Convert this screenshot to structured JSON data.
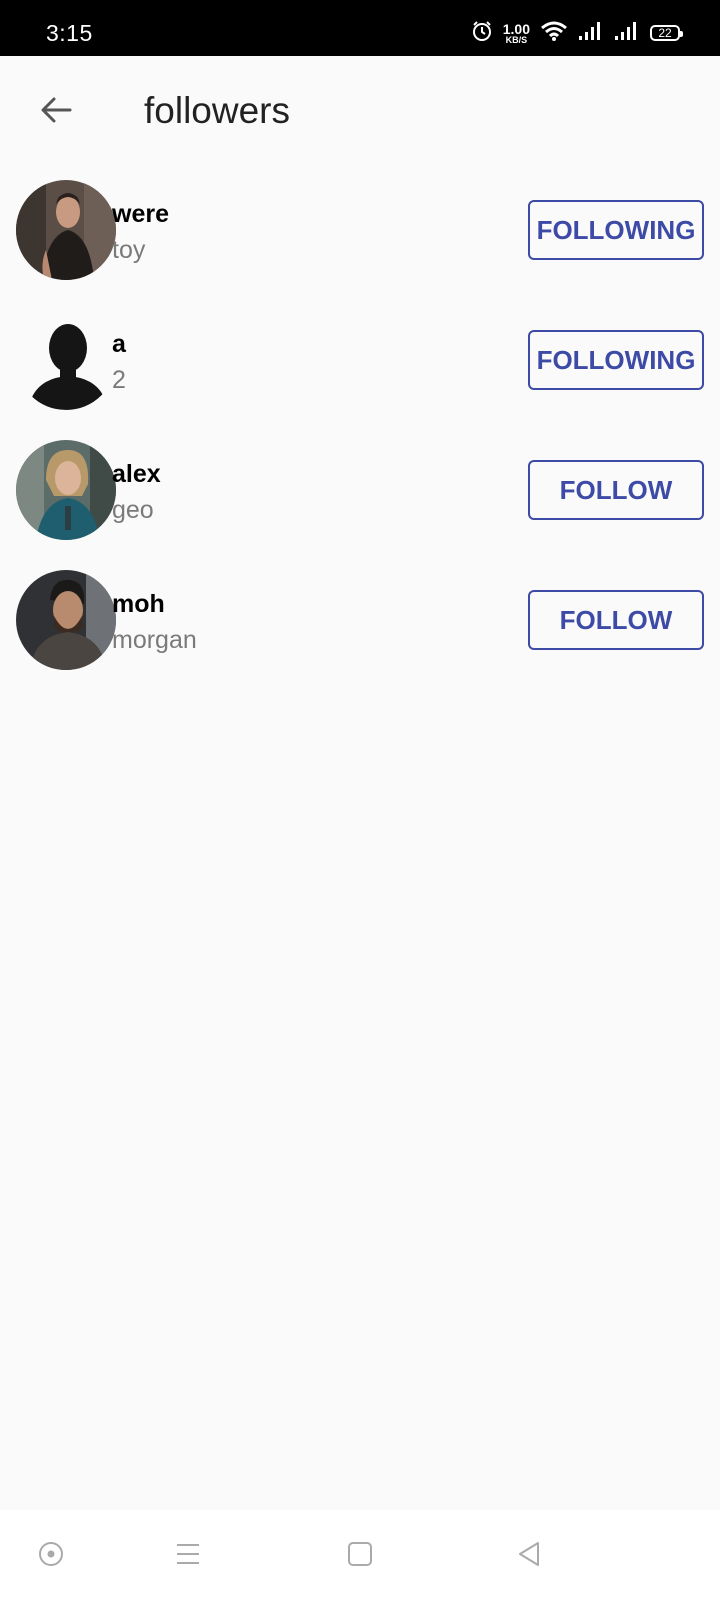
{
  "status_bar": {
    "time": "3:15",
    "speed_value": "1.00",
    "speed_unit": "KB/S",
    "battery": "22",
    "icons": [
      "alarm-icon",
      "wifi-icon",
      "signal-icon",
      "signal-icon",
      "battery-icon"
    ]
  },
  "app_bar": {
    "title": "followers",
    "back_icon": "arrow-left-icon"
  },
  "followers": [
    {
      "name": "were",
      "handle": "toy",
      "button": "FOLLOWING",
      "avatar": "photo"
    },
    {
      "name": "a",
      "handle": "2",
      "button": "FOLLOWING",
      "avatar": "default-silhouette"
    },
    {
      "name": "alex",
      "handle": "geo",
      "button": "FOLLOW",
      "avatar": "photo"
    },
    {
      "name": "moh",
      "handle": "morgan",
      "button": "FOLLOW",
      "avatar": "photo"
    }
  ],
  "nav_bar": {
    "icons": [
      "assistant-icon",
      "menu-icon",
      "home-icon",
      "back-icon"
    ]
  },
  "colors": {
    "accent": "#3d4aa6",
    "background": "#fafafa",
    "status_bar": "#000000",
    "secondary_text": "#7a7a7a"
  }
}
